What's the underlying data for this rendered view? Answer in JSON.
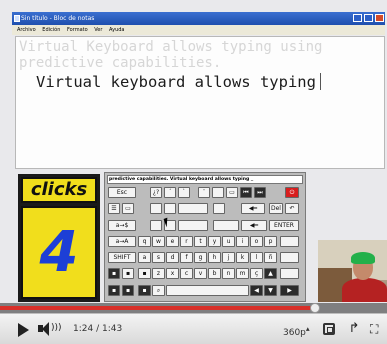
{
  "notepad": {
    "window_title": "Sin título - Bloc de notas",
    "menu": [
      "Archivo",
      "Edición",
      "Formato",
      "Ver",
      "Ayuda"
    ],
    "ghost_line1": "Virtual Keyboard allows typing using",
    "ghost_line2": "predictive capabilities.",
    "typed_text": "Virtual keyboard allows typing"
  },
  "clicks": {
    "label": "clicks",
    "count": "4"
  },
  "keyboard": {
    "prediction": "predictive capabilities. Virtual keyboard allows typing _",
    "keys": {
      "esc": "Esc",
      "q_inv": "¿?",
      "acute": "´",
      "grave": "`",
      "diaer": "¨",
      "tab": "a→$",
      "arrow_a": "a→A",
      "shift": "SHIFT",
      "enter": "ENTER",
      "del": "Del",
      "row1": [
        "q",
        "w",
        "e",
        "r",
        "t",
        "y",
        "u",
        "i",
        "o",
        "p"
      ],
      "row2": [
        "a",
        "s",
        "d",
        "f",
        "g",
        "h",
        "j",
        "k",
        "l",
        "ñ"
      ],
      "row3": [
        "z",
        "x",
        "c",
        "v",
        "b",
        "n",
        "m",
        "ç"
      ]
    },
    "accent_color": "#d81e1e"
  },
  "player": {
    "time": "1:24 / 1:43",
    "quality": "360p",
    "progress": 0.815,
    "progress_color": "#d8302a"
  }
}
